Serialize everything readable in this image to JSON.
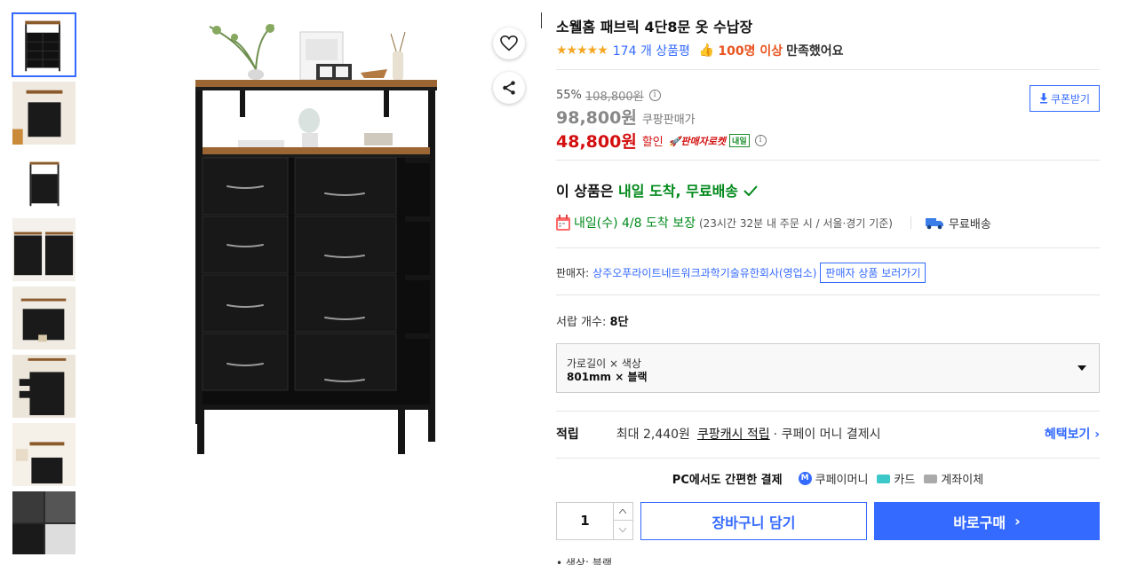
{
  "product": {
    "title": "소웰홈 패브릭 4단8문 옷 수납장",
    "stars": "★★★★★",
    "review_count": "174 개 상품평",
    "thumb_icon": "👍",
    "satisfaction_count": "100명 이상",
    "satisfaction_text": "만족했어요"
  },
  "price": {
    "discount_rate": "55%",
    "original_price": "108,800원",
    "coupang_price": "98,800원",
    "coupang_label": "쿠팡판매가",
    "sale_price": "48,800원",
    "sale_label": "할인",
    "rocket_label": "판매자로켓",
    "tomorrow_badge": "내일",
    "coupon_button": "쿠폰받기"
  },
  "delivery": {
    "headline_prefix": "이 상품은",
    "headline_green": "내일 도착, 무료배송",
    "date_text": "내일(수) 4/8 도착 보장",
    "date_note": "(23시간 32분 내 주문 시 / 서울·경기 기준)",
    "free_shipping": "무료배송"
  },
  "seller": {
    "label": "판매자:",
    "name": "상주오푸라이트네트워크과학기술유한회사(영업소)",
    "button": "판매자 상품 보러가기"
  },
  "option": {
    "drawer_label": "서랍 개수:",
    "drawer_value": "8단",
    "select_label": "가로길이 × 색상",
    "select_value": "801mm × 블랙"
  },
  "reward": {
    "title": "적립",
    "max": "최대 2,440원",
    "link": "쿠팡캐시 적립",
    "rest": "· 쿠페이 머니 결제시",
    "benefit": "혜택보기 ›"
  },
  "payment": {
    "title": "PC에서도 간편한 결제",
    "coupay_icon_letter": "M",
    "coupay": "쿠페이머니",
    "card": "카드",
    "bank": "계좌이체"
  },
  "purchase": {
    "quantity": "1",
    "cart_button": "장바구니 담기",
    "buy_button": "바로구매",
    "buy_chevron": "›"
  },
  "bottom": {
    "bullet": "•  색상: 블랙"
  },
  "colors": {
    "accent_blue": "#346aff",
    "sale_red": "#d30f0f",
    "delivery_green": "#00891a",
    "satisfaction_orange": "#e8541e",
    "star_yellow": "#f5a623"
  },
  "icons": [
    "heart-icon",
    "share-icon",
    "calendar-icon",
    "truck-icon",
    "info-icon",
    "download-icon"
  ]
}
